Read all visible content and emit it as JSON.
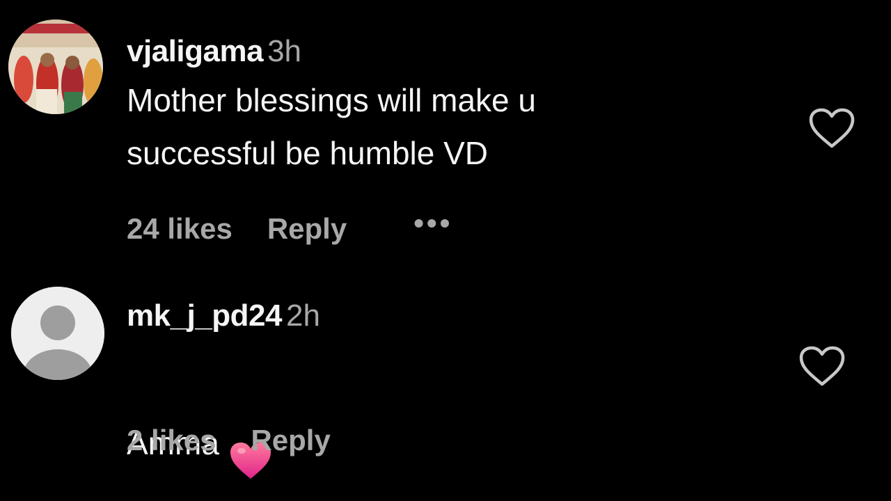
{
  "comments": [
    {
      "username": "vjaligama",
      "time": "3h",
      "text": "Mother blessings will make u\nsuccessful be humble VD",
      "likes": "24 likes",
      "reply": "Reply",
      "more": "•••",
      "emoji": ""
    },
    {
      "username": "mk_j_pd24",
      "time": "2h",
      "text": "Amma",
      "likes": "2 likes",
      "reply": "Reply",
      "emoji": "heart-emoji"
    }
  ],
  "colors": {
    "background": "#000000",
    "primary_text": "#f5f5f5",
    "secondary_text": "#a8a8a8",
    "heart_gradient_top": "#ff6b9a",
    "heart_gradient_bottom": "#e0248a"
  },
  "icons": {
    "like": "heart-outline-icon",
    "default_avatar": "default-avatar-icon"
  }
}
